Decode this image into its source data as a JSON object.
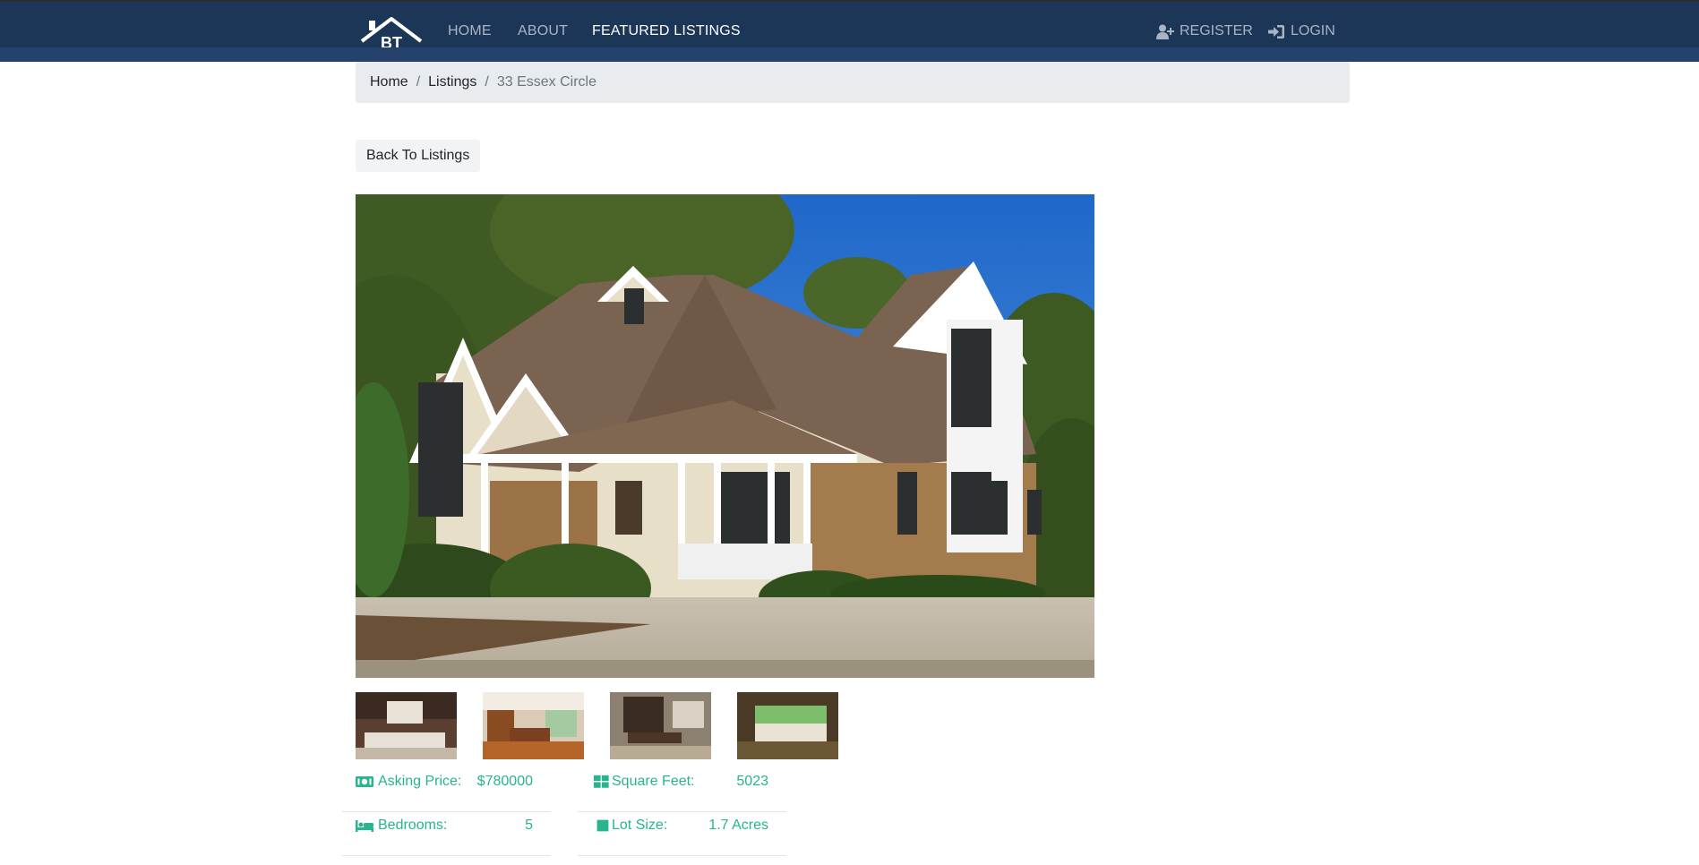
{
  "nav": {
    "logo_text": "BT",
    "home": "HOME",
    "about": "ABOUT",
    "featured": "FEATURED LISTINGS",
    "register": "REGISTER",
    "login": "LOGIN"
  },
  "breadcrumb": {
    "home": "Home",
    "listings": "Listings",
    "separator": "/",
    "current": "33 Essex Circle"
  },
  "back_button": "Back To Listings",
  "details": {
    "left": [
      {
        "icon": "money-icon",
        "label": "Asking Price:",
        "value": "$780000"
      },
      {
        "icon": "bed-icon",
        "label": "Bedrooms:",
        "value": "5"
      }
    ],
    "right": [
      {
        "icon": "grid-icon",
        "label": "Square Feet:",
        "value": "5023"
      },
      {
        "icon": "square-icon",
        "label": "Lot Size:",
        "value": "1.7 Acres"
      }
    ]
  },
  "colors": {
    "navbar": "#1c3658",
    "accent": "#26b58f",
    "breadcrumb_bg": "#e9ecef"
  }
}
